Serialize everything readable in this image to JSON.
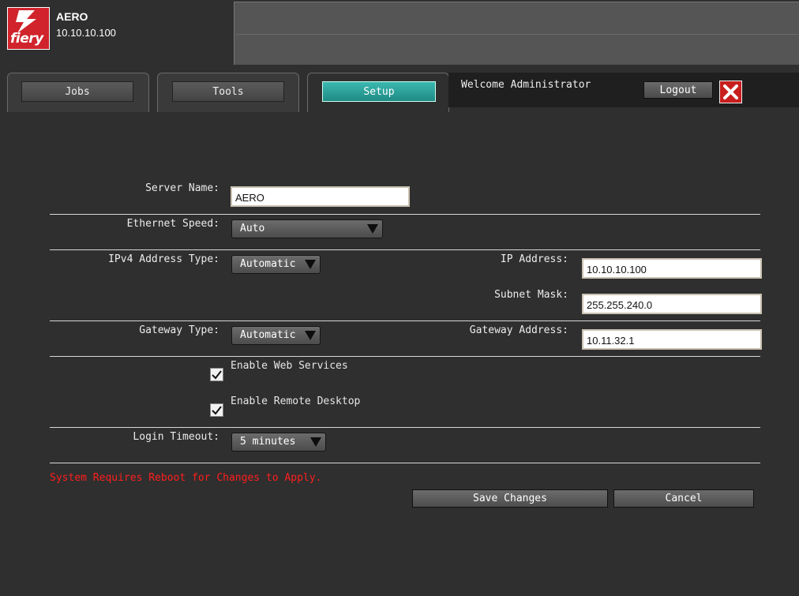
{
  "header": {
    "logo_text": "fiery",
    "server_name": "AERO",
    "server_ip": "10.10.10.100"
  },
  "tabs": [
    {
      "label": "Jobs",
      "active": false
    },
    {
      "label": "Tools",
      "active": false
    },
    {
      "label": "Setup",
      "active": true
    }
  ],
  "session": {
    "welcome": "Welcome Administrator",
    "logout_label": "Logout",
    "close_icon": "close-x-icon"
  },
  "form": {
    "server_name": {
      "label": "Server Name:",
      "value": "AERO"
    },
    "ethernet_speed": {
      "label": "Ethernet Speed:",
      "value": "Auto"
    },
    "ipv4_type": {
      "label": "IPv4 Address Type:",
      "value": "Automatic"
    },
    "ip_address": {
      "label": "IP Address:",
      "value": "10.10.10.100"
    },
    "subnet_mask": {
      "label": "Subnet Mask:",
      "value": "255.255.240.0"
    },
    "gateway_type": {
      "label": "Gateway Type:",
      "value": "Automatic"
    },
    "gateway_address": {
      "label": "Gateway Address:",
      "value": "10.11.32.1"
    },
    "web_services": {
      "label": "Enable Web Services",
      "checked": true
    },
    "remote_desktop": {
      "label": "Enable Remote Desktop",
      "checked": true
    },
    "login_timeout": {
      "label": "Login Timeout:",
      "value": "5 minutes"
    }
  },
  "message": "System Requires Reboot for Changes to Apply.",
  "actions": {
    "save_label": "Save Changes",
    "cancel_label": "Cancel"
  },
  "colors": {
    "accent_tab": "#2aa39c",
    "warning": "#ff1e1e",
    "logo_red": "#d0232b"
  }
}
